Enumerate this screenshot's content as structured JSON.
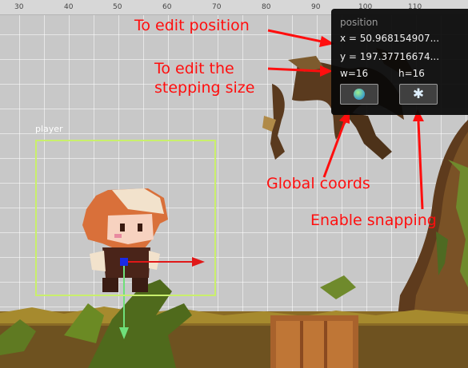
{
  "ruler": {
    "ticks": [
      "30",
      "40",
      "50",
      "60",
      "70",
      "80",
      "90",
      "100",
      "110"
    ]
  },
  "entity": {
    "name": "player"
  },
  "panel": {
    "title": "position",
    "x_text": "x = 50.968154907...",
    "y_text": "y = 197.37716674...",
    "w_text": "w=16",
    "h_text": "h=16",
    "buttons": {
      "global_coords": "globe-icon",
      "snapping": "snowflake-icon"
    }
  },
  "annotations": {
    "edit_position": "To edit position",
    "stepping_line1": "To edit the",
    "stepping_line2": "stepping size",
    "global_coords": "Global coords",
    "enable_snapping": "Enable snapping"
  },
  "colors": {
    "annotation": "#ff0e0e",
    "bounding_box": "#c9ef6c",
    "gizmo_x": "#e01818",
    "gizmo_y": "#6fe07a",
    "gizmo_center": "#1a2ae6"
  }
}
